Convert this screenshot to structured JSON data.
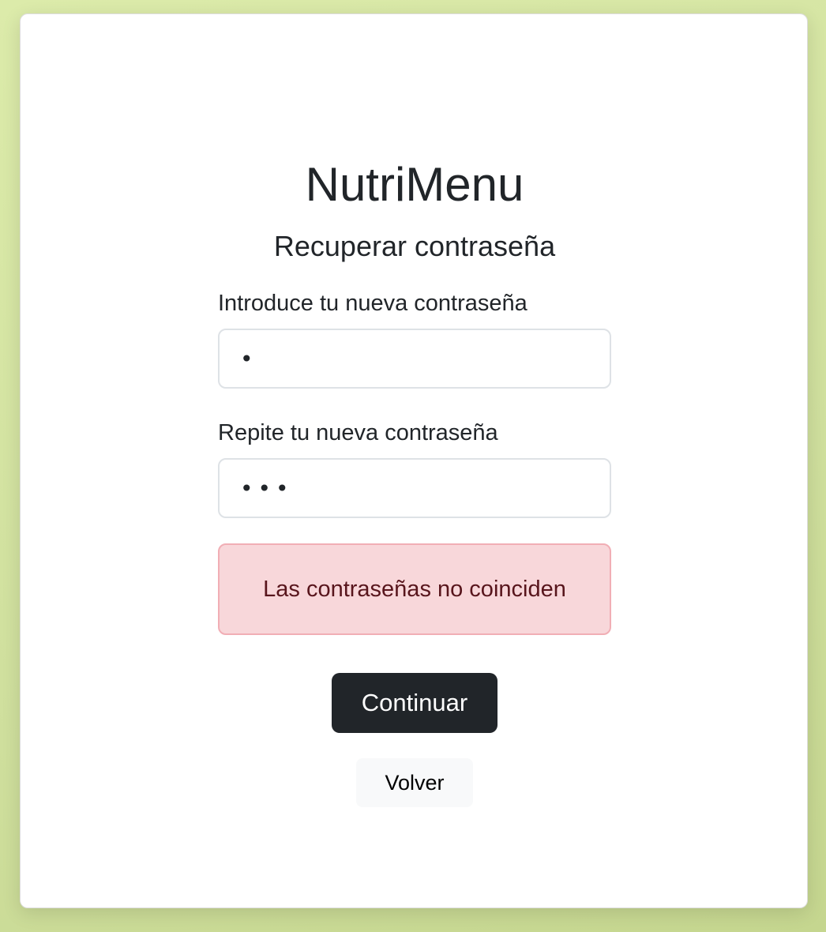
{
  "app": {
    "title": "NutriMenu",
    "subtitle": "Recuperar contraseña"
  },
  "form": {
    "new_password": {
      "label": "Introduce tu nueva contraseña",
      "value": "•"
    },
    "repeat_password": {
      "label": "Repite tu nueva contraseña",
      "value": "•••"
    },
    "error_message": "Las contraseñas no coinciden",
    "submit_label": "Continuar",
    "back_label": "Volver"
  },
  "colors": {
    "background": "#d4e4a0",
    "primary_button": "#212529",
    "alert_background": "#f8d7da",
    "alert_border": "#f1aeb5",
    "alert_text": "#58151c",
    "secondary_button": "#f8f9fa"
  }
}
